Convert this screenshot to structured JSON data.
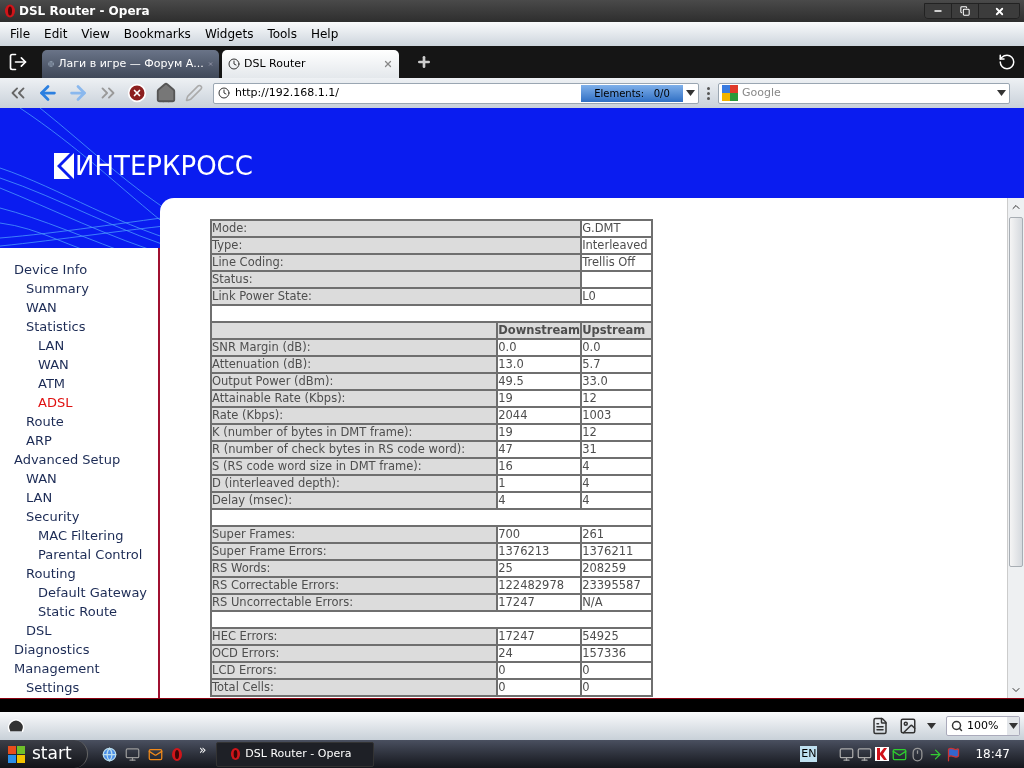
{
  "window": {
    "title": "DSL Router - Opera"
  },
  "menu": [
    "File",
    "Edit",
    "View",
    "Bookmarks",
    "Widgets",
    "Tools",
    "Help"
  ],
  "tabs": [
    {
      "label": "Лаги в игре — Форум А...",
      "selected": false
    },
    {
      "label": "DSL Router",
      "selected": true
    }
  ],
  "address_bar": {
    "url": "http://192.168.1.1/",
    "elements": "Elements:   0/0"
  },
  "search": {
    "placeholder": "Google"
  },
  "page": {
    "logo": "ИНТЕРКРОСС",
    "sidebar": [
      {
        "label": "Device Info",
        "selected": false,
        "children": [
          {
            "label": "Summary",
            "selected": false
          },
          {
            "label": "WAN",
            "selected": false
          },
          {
            "label": "Statistics",
            "selected": false,
            "children": [
              {
                "label": "LAN",
                "selected": false
              },
              {
                "label": "WAN",
                "selected": false
              },
              {
                "label": "ATM",
                "selected": false
              },
              {
                "label": "ADSL",
                "selected": true
              }
            ]
          },
          {
            "label": "Route",
            "selected": false
          },
          {
            "label": "ARP",
            "selected": false
          }
        ]
      },
      {
        "label": "Advanced Setup",
        "selected": false,
        "children": [
          {
            "label": "WAN",
            "selected": false
          },
          {
            "label": "LAN",
            "selected": false
          },
          {
            "label": "Security",
            "selected": false,
            "children": [
              {
                "label": "MAC Filtering",
                "selected": false
              },
              {
                "label": "Parental Control",
                "selected": false
              }
            ]
          },
          {
            "label": "Routing",
            "selected": false,
            "children": [
              {
                "label": "Default Gateway",
                "selected": false
              },
              {
                "label": "Static Route",
                "selected": false
              }
            ]
          },
          {
            "label": "DSL",
            "selected": false
          }
        ]
      },
      {
        "label": "Diagnostics",
        "selected": false
      },
      {
        "label": "Management",
        "selected": false,
        "children": [
          {
            "label": "Settings",
            "selected": false
          }
        ]
      }
    ],
    "table": {
      "sections": [
        {
          "rows": [
            {
              "label": "Mode:",
              "values": [
                "G.DMT"
              ]
            },
            {
              "label": "Type:",
              "values": [
                "Interleaved"
              ]
            },
            {
              "label": "Line Coding:",
              "values": [
                "Trellis Off"
              ]
            },
            {
              "label": "Status:",
              "values": []
            },
            {
              "label": "Link Power State:",
              "values": [
                "L0"
              ]
            }
          ]
        },
        {
          "columns": [
            "Downstream",
            "Upstream"
          ],
          "rows": [
            {
              "label": "SNR Margin (dB):",
              "values": [
                "0.0",
                "0.0"
              ]
            },
            {
              "label": "Attenuation (dB):",
              "values": [
                "13.0",
                "5.7"
              ]
            },
            {
              "label": "Output Power (dBm):",
              "values": [
                "49.5",
                "33.0"
              ]
            },
            {
              "label": "Attainable Rate (Kbps):",
              "values": [
                "19",
                "12"
              ]
            },
            {
              "label": "Rate (Kbps):",
              "values": [
                "2044",
                "1003"
              ]
            },
            {
              "label": "K (number of bytes in DMT frame):",
              "values": [
                "19",
                "12"
              ]
            },
            {
              "label": "R (number of check bytes in RS code word):",
              "values": [
                "47",
                "31"
              ]
            },
            {
              "label": "S (RS code word size in DMT frame):",
              "values": [
                "16",
                "4"
              ]
            },
            {
              "label": "D (interleaved depth):",
              "values": [
                "1",
                "4"
              ]
            },
            {
              "label": "Delay (msec):",
              "values": [
                "4",
                "4"
              ]
            }
          ]
        },
        {
          "rows": [
            {
              "label": "Super Frames:",
              "values": [
                "700",
                "261"
              ]
            },
            {
              "label": "Super Frame Errors:",
              "values": [
                "1376213",
                "1376211"
              ]
            },
            {
              "label": "RS Words:",
              "values": [
                "25",
                "208259"
              ]
            },
            {
              "label": "RS Correctable Errors:",
              "values": [
                "122482978",
                "23395587"
              ]
            },
            {
              "label": "RS Uncorrectable Errors:",
              "values": [
                "17247",
                "N/A"
              ]
            }
          ]
        },
        {
          "rows": [
            {
              "label": "HEC Errors:",
              "values": [
                "17247",
                "54925"
              ]
            },
            {
              "label": "OCD Errors:",
              "values": [
                "24",
                "157336"
              ]
            },
            {
              "label": "LCD Errors:",
              "values": [
                "0",
                "0"
              ]
            },
            {
              "label": "Total Cells:",
              "values": [
                "0",
                "0"
              ]
            }
          ]
        }
      ]
    }
  },
  "status_bar": {
    "zoom": "100%"
  },
  "taskbar": {
    "start": "start",
    "overflow": "»",
    "tasks": [
      {
        "label": "DSL Router - Opera"
      }
    ],
    "language": "EN",
    "clock": "18:47"
  }
}
